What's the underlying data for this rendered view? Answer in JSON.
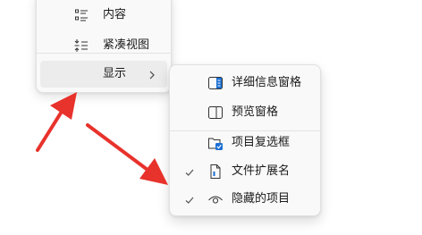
{
  "colors": {
    "menu_bg": "#f9f9f9",
    "hover_bg": "#ececec",
    "separator": "#e3e3e3",
    "text": "#1a1a1a",
    "accent_blue": "#1a6fd4",
    "annotation_red": "#e8322c"
  },
  "parent_menu": {
    "items": [
      {
        "label": "内容",
        "icon": "details-list-icon"
      },
      {
        "label": "紧凑视图",
        "icon": "compact-view-icon"
      },
      {
        "label": "显示",
        "icon": "chevron-right-icon",
        "highlighted": true
      }
    ]
  },
  "show_submenu": {
    "items": [
      {
        "label": "详细信息窗格",
        "icon": "details-pane-icon",
        "checked": false
      },
      {
        "label": "预览窗格",
        "icon": "preview-pane-icon",
        "checked": false
      },
      {
        "label": "项目复选框",
        "icon": "item-checkbox-icon",
        "checked": false
      },
      {
        "label": "文件扩展名",
        "icon": "file-extension-icon",
        "checked": true
      },
      {
        "label": "隐藏的项目",
        "icon": "eye-icon",
        "checked": true
      }
    ]
  }
}
